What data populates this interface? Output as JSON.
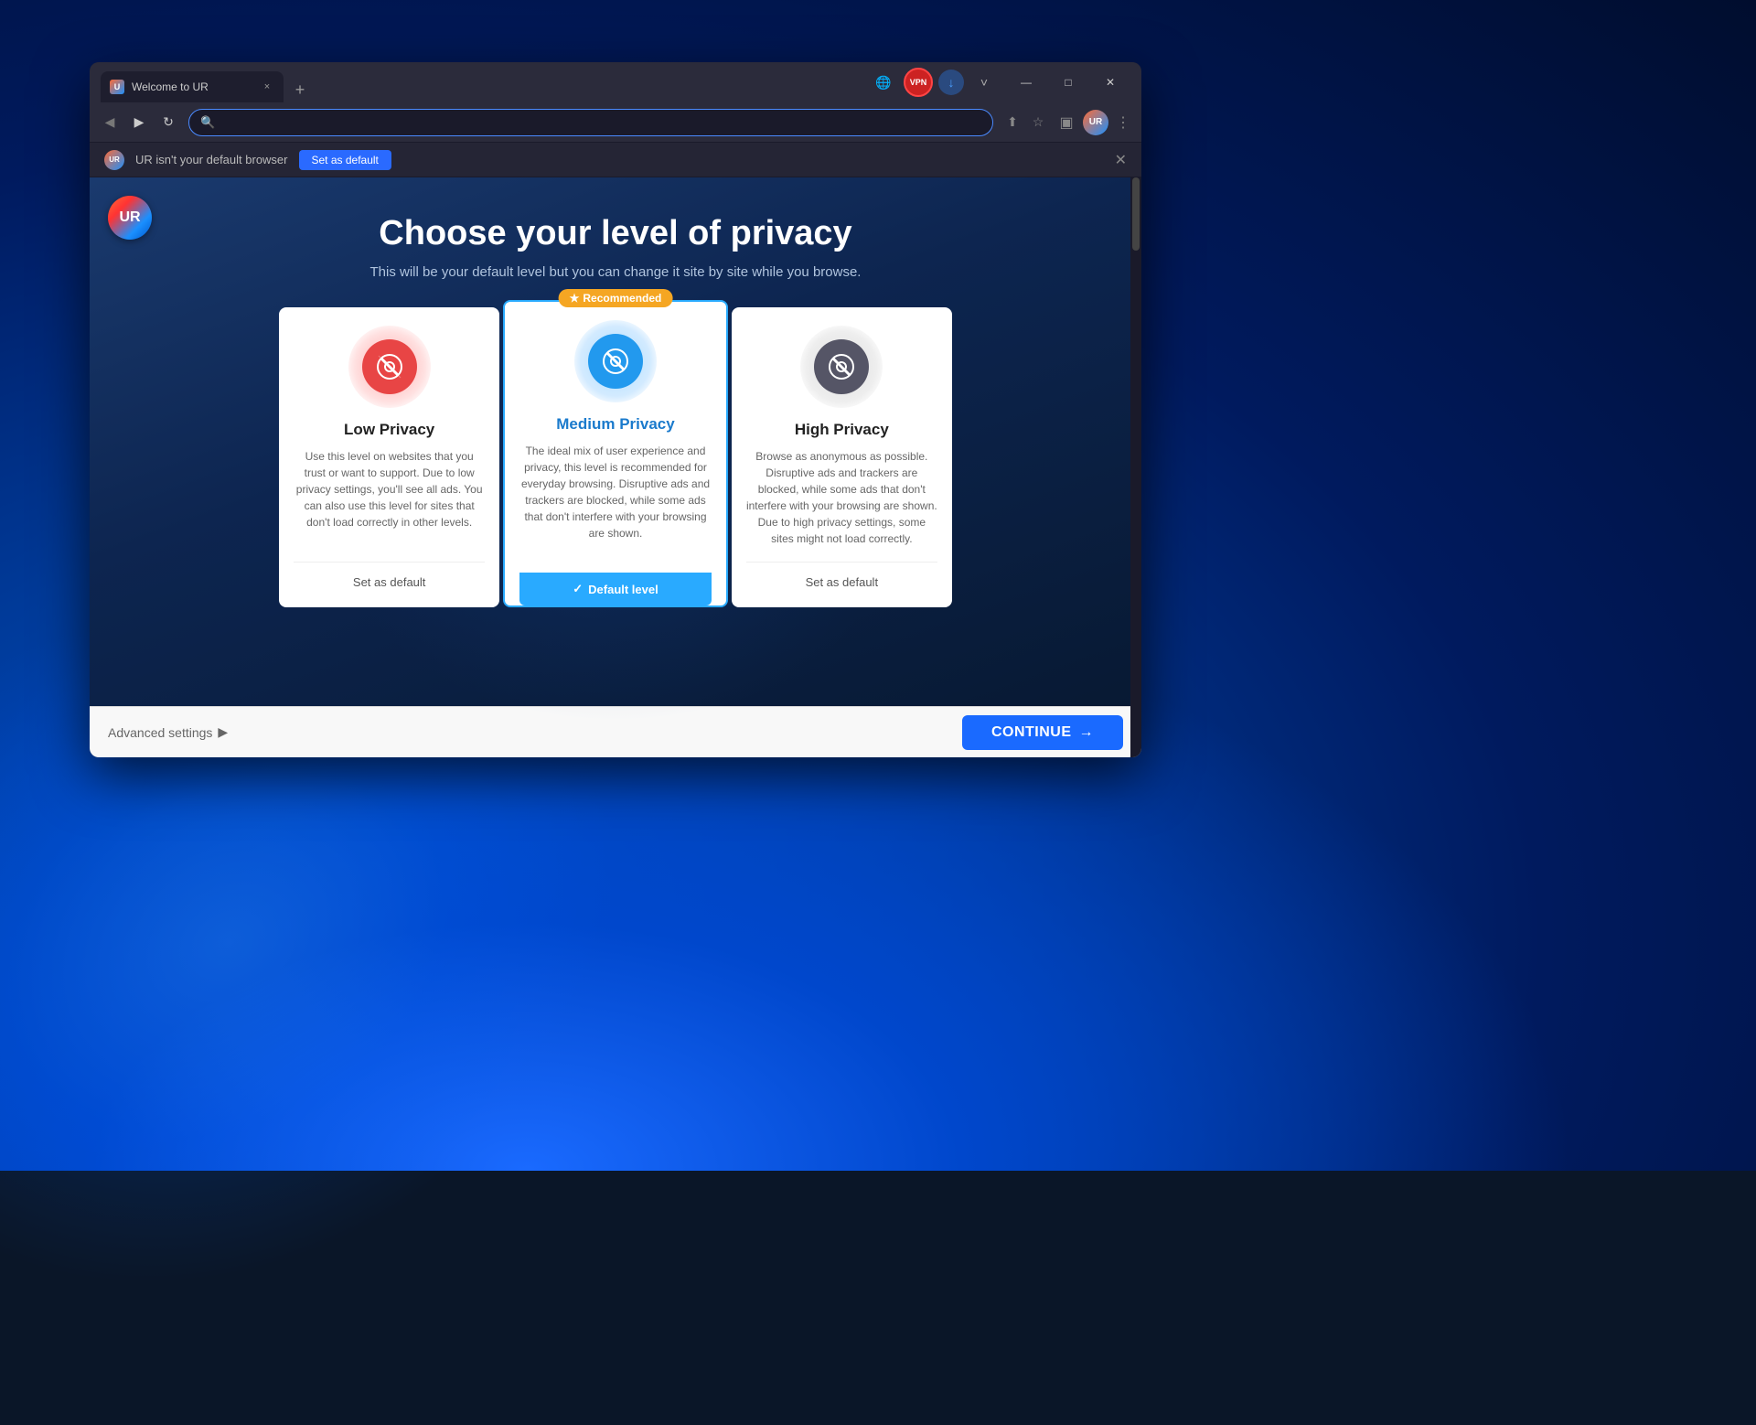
{
  "desktop": {
    "bg_color": "#0a1628"
  },
  "browser": {
    "tab": {
      "favicon_label": "U",
      "title": "Welcome to UR",
      "close_label": "×"
    },
    "new_tab_label": "+",
    "toolbar": {
      "back_icon": "◀",
      "forward_icon": "▶",
      "refresh_icon": "↻",
      "search_placeholder": "",
      "vpn_label": "VPN",
      "share_icon": "⬆",
      "star_icon": "☆",
      "sidebar_icon": "▣",
      "profile_label": "UR",
      "menu_icon": "⋮",
      "minimize_icon": "—",
      "maximize_icon": "□",
      "close_icon": "✕",
      "chevron_icon": "˅"
    },
    "banner": {
      "text": "UR isn't your default browser",
      "button_label": "Set as default",
      "close_icon": "✕"
    }
  },
  "page": {
    "logo_label": "UR",
    "heading": "Choose your level of privacy",
    "subheading": "This will be your default level but you can change it site by site while you browse.",
    "cards": [
      {
        "id": "low",
        "title": "Low Privacy",
        "icon_color": "red",
        "description": "Use this level on websites that you trust or want to support. Due to low privacy settings, you'll see all ads. You can also use this level for sites that don't load correctly in other levels.",
        "footer_label": "Set as default",
        "is_default": false,
        "recommended": false
      },
      {
        "id": "medium",
        "title": "Medium Privacy",
        "icon_color": "blue",
        "description": "The ideal mix of user experience and privacy, this level is recommended for everyday browsing. Disruptive ads and trackers are blocked, while some ads that don't interfere with your browsing are shown.",
        "footer_label": "Default level",
        "is_default": true,
        "recommended": true,
        "recommended_label": "Recommended",
        "recommended_star": "★"
      },
      {
        "id": "high",
        "title": "High Privacy",
        "icon_color": "gray",
        "description": "Browse as anonymous as possible. Disruptive ads and trackers are blocked, while some ads that don't interfere with your browsing are shown. Due to high privacy settings, some sites might not load correctly.",
        "footer_label": "Set as default",
        "is_default": false,
        "recommended": false
      }
    ],
    "bottom_bar": {
      "advanced_label": "Advanced settings",
      "advanced_arrow": "▶",
      "continue_label": "CONTINUE",
      "continue_arrow": "→"
    }
  }
}
